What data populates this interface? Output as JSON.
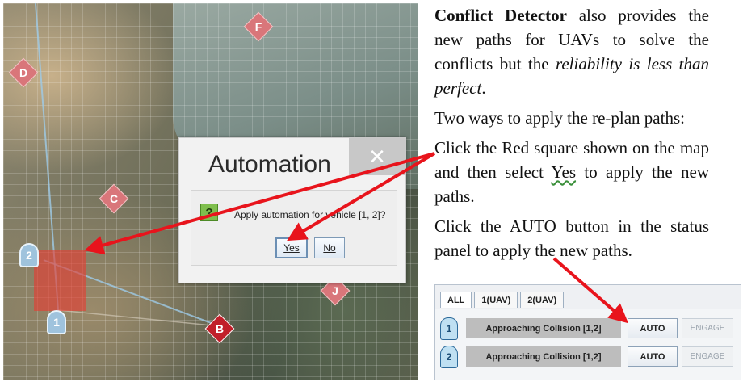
{
  "map": {
    "waypoints": [
      {
        "label": "F"
      },
      {
        "label": "D"
      },
      {
        "label": "C"
      },
      {
        "label": "J"
      },
      {
        "label": "B"
      }
    ],
    "uavs": [
      {
        "label": "2"
      },
      {
        "label": "1"
      }
    ]
  },
  "dialog": {
    "title": "Automation",
    "close_glyph": "✕",
    "icon_glyph": "?",
    "message": "Apply automation for vehicle [1, 2]?",
    "yes_label": "Yes",
    "no_label": "No"
  },
  "text": {
    "p1_bold": "Conflict Detector",
    "p1_a": " also provides the new paths for UAVs to solve the conflicts but the ",
    "p1_italic": "reliability is less than perfect",
    "p1_end": ".",
    "p2": "Two ways to apply the re-plan paths:",
    "p3_a": "Click the Red square shown on the map and then select ",
    "p3_yes": "Yes",
    "p3_b": " to apply the new paths.",
    "p4": "Click the AUTO button in the status panel to apply the new paths."
  },
  "status": {
    "tabs": [
      {
        "underline": "A",
        "rest": "LL"
      },
      {
        "underline": "1",
        "rest": "(UAV)"
      },
      {
        "underline": "2",
        "rest": "(UAV)"
      }
    ],
    "rows": [
      {
        "vehicle": "1",
        "alert": "Approaching Collision [1,2]",
        "auto": "AUTO",
        "engage": "ENGAGE"
      },
      {
        "vehicle": "2",
        "alert": "Approaching Collision [1,2]",
        "auto": "AUTO",
        "engage": "ENGAGE"
      }
    ]
  },
  "colors": {
    "arrow": "#e8141c",
    "waypoint": "#d9767a",
    "waypoint_selected": "#c11f2a",
    "conflict_square": "#e63c32"
  }
}
